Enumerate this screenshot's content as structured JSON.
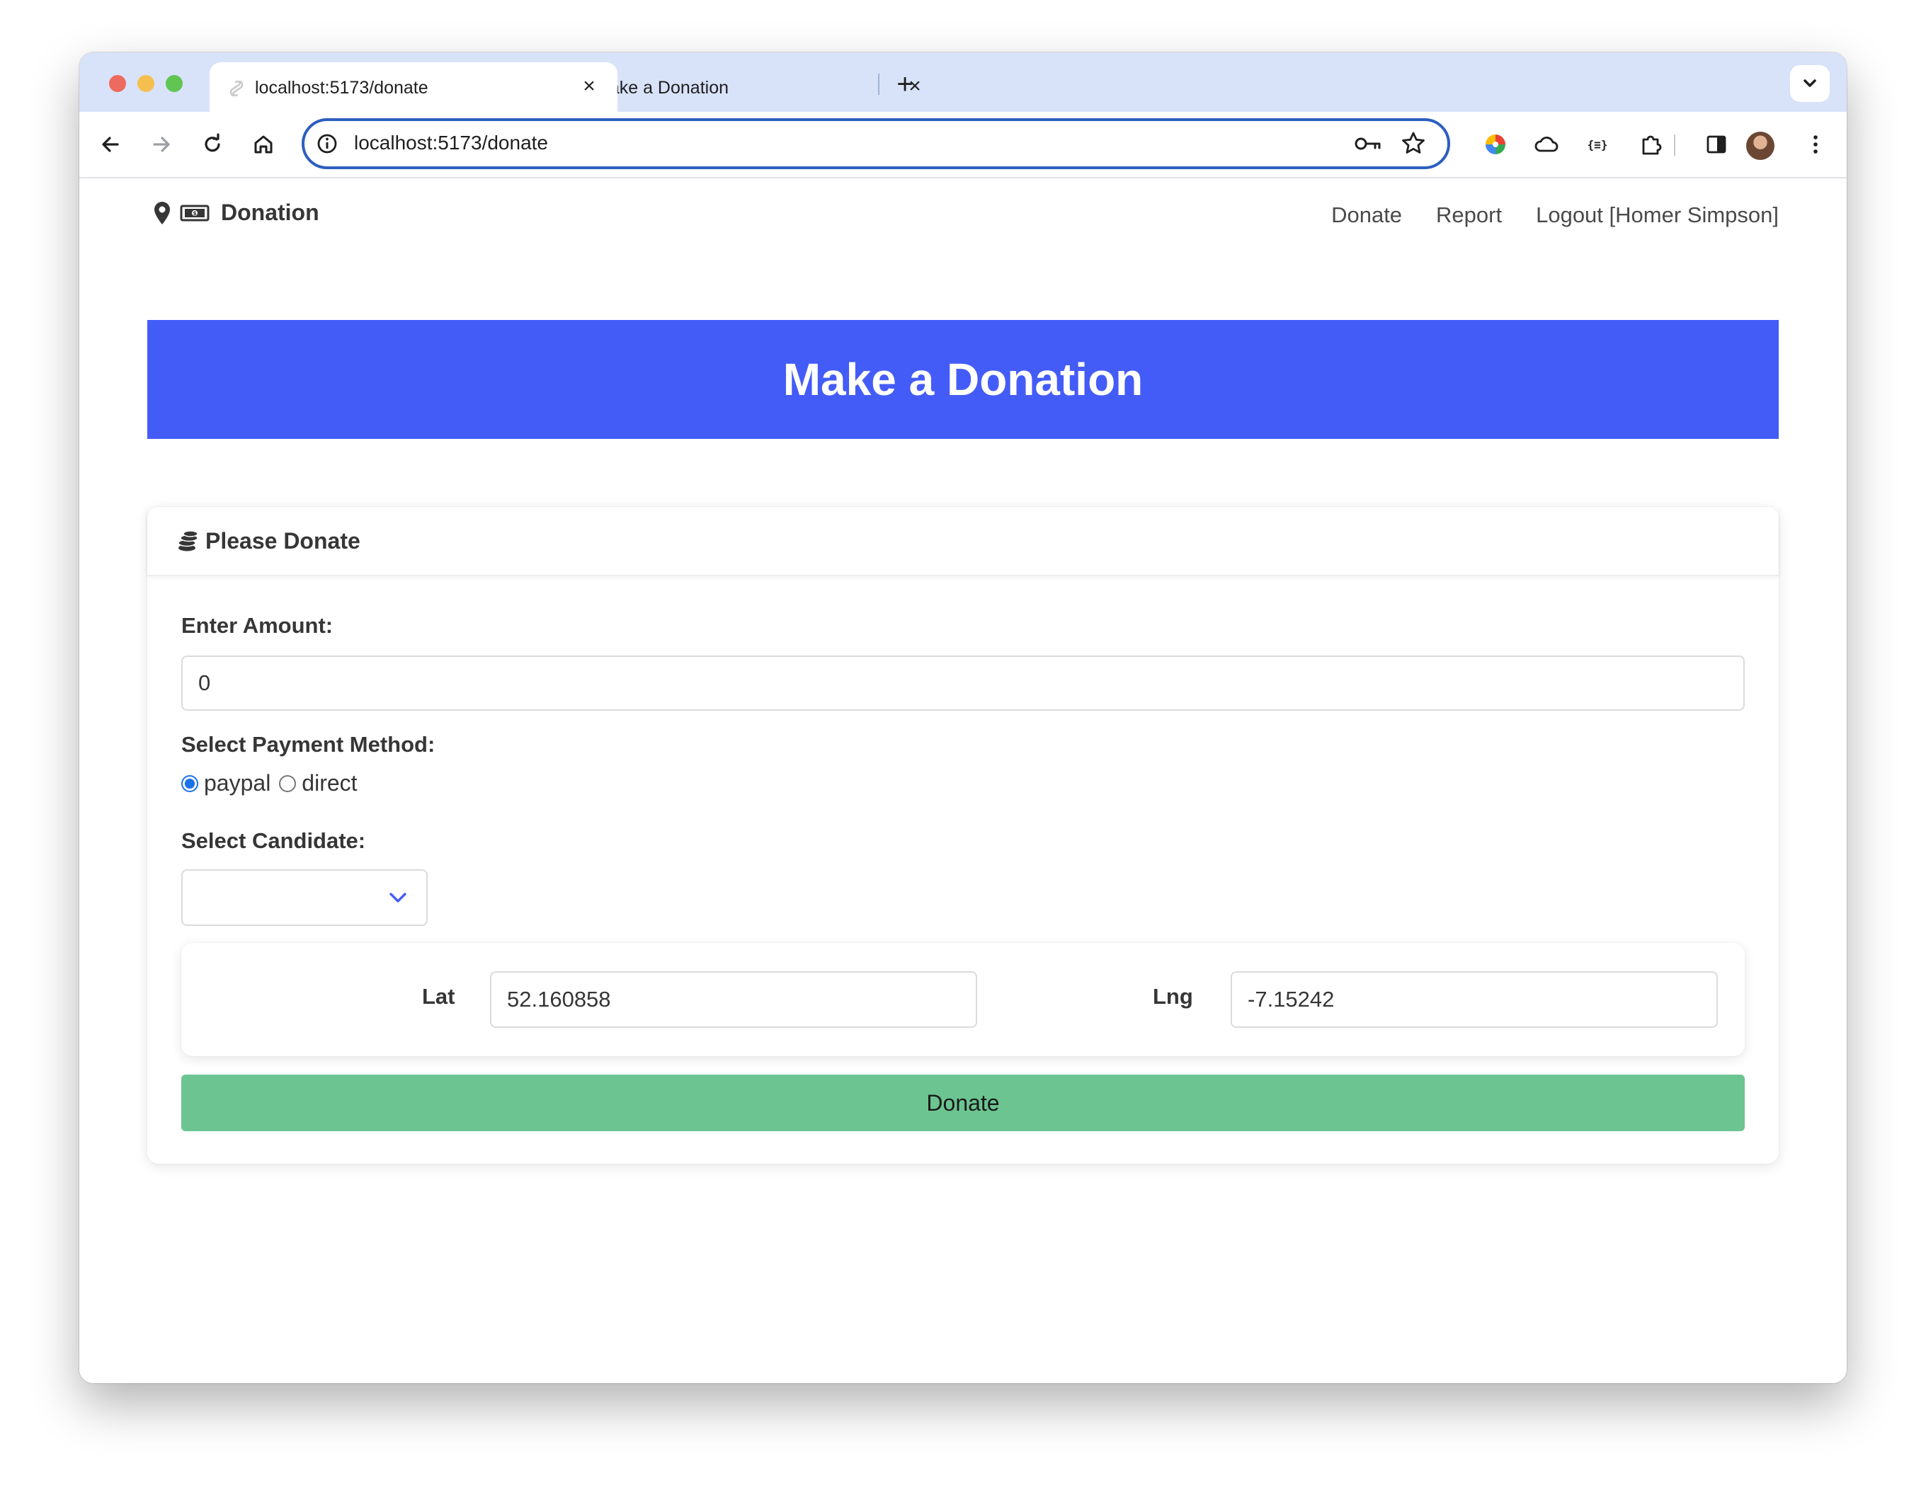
{
  "browser": {
    "tabs": [
      {
        "title": "localhost:5173/donate",
        "active": true,
        "favicon": "svelte-logo-icon"
      },
      {
        "title": "Make a Donation",
        "active": false,
        "favicon": "globe-icon"
      }
    ],
    "url": "localhost:5173/donate"
  },
  "navbar": {
    "brand": "Donation",
    "links": [
      "Donate",
      "Report",
      "Logout [Homer Simpson]"
    ]
  },
  "hero": {
    "title": "Make a Donation",
    "color": "#445cf7"
  },
  "card": {
    "title": "Please Donate",
    "amount_label": "Enter Amount:",
    "amount_value": "0",
    "payment_label": "Select Payment Method:",
    "payment_options": [
      {
        "label": "paypal",
        "checked": true
      },
      {
        "label": "direct",
        "checked": false
      }
    ],
    "candidate_label": "Select Candidate:",
    "candidate_value": "",
    "lat_label": "Lat",
    "lat_value": "52.160858",
    "lng_label": "Lng",
    "lng_value": "-7.15242",
    "submit_label": "Donate",
    "submit_color": "#6cc591"
  }
}
